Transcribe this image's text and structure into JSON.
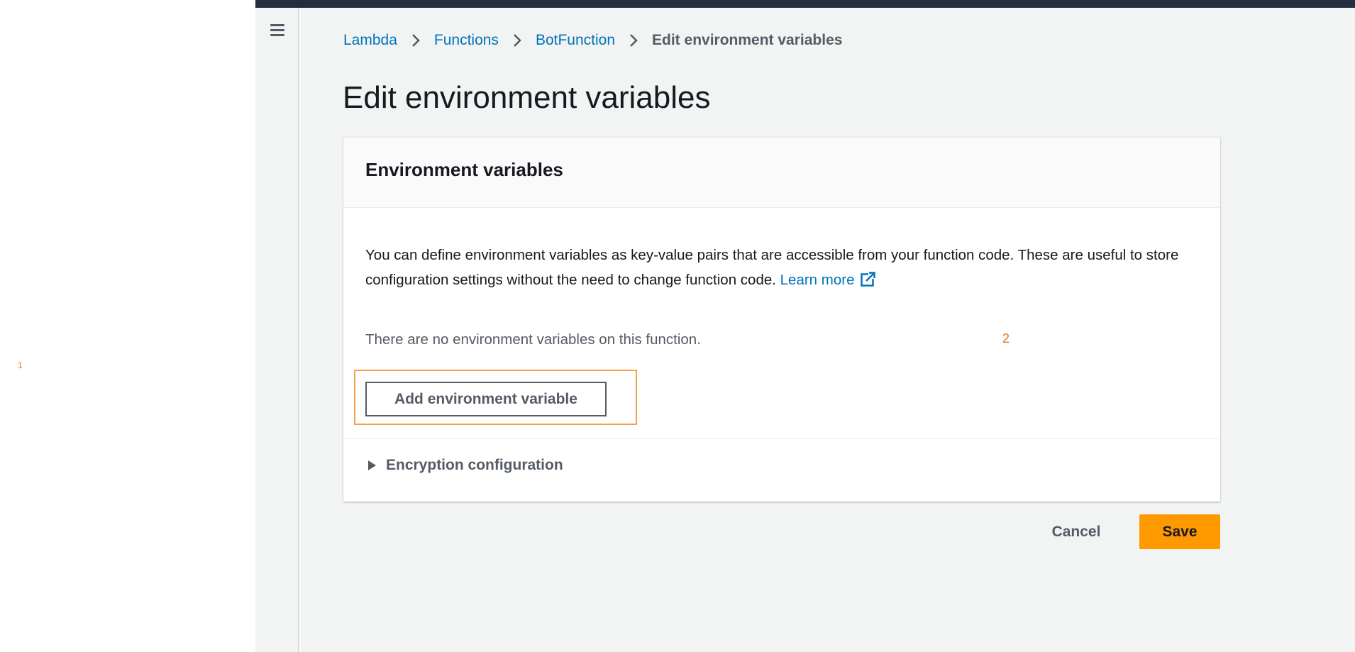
{
  "markers": {
    "one": "1",
    "two": "2"
  },
  "breadcrumb": {
    "items": [
      {
        "label": "Lambda"
      },
      {
        "label": "Functions"
      },
      {
        "label": "BotFunction"
      }
    ],
    "current": "Edit environment variables"
  },
  "page": {
    "title": "Edit environment variables"
  },
  "panel": {
    "title": "Environment variables",
    "description": "You can define environment variables as key-value pairs that are accessible from your function code. These are useful to store configuration settings without the need to change function code.",
    "learn_more": "Learn more",
    "empty_text": "There are no environment variables on this function.",
    "add_button": "Add environment variable",
    "encryption_label": "Encryption configuration"
  },
  "actions": {
    "cancel": "Cancel",
    "save": "Save"
  },
  "colors": {
    "topbar": "#232f3e",
    "link": "#0073bb",
    "primary": "#ff9900",
    "highlight": "#f5a14a",
    "background": "#f2f3f3"
  }
}
